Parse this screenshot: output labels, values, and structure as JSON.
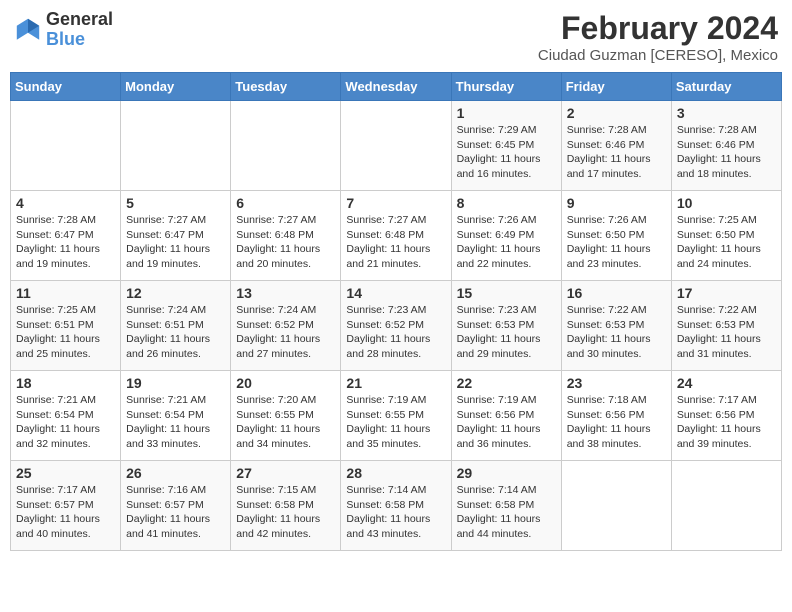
{
  "logo": {
    "general": "General",
    "blue": "Blue"
  },
  "title": {
    "month_year": "February 2024",
    "location": "Ciudad Guzman [CERESO], Mexico"
  },
  "days_of_week": [
    "Sunday",
    "Monday",
    "Tuesday",
    "Wednesday",
    "Thursday",
    "Friday",
    "Saturday"
  ],
  "weeks": [
    [
      {
        "day": "",
        "info": ""
      },
      {
        "day": "",
        "info": ""
      },
      {
        "day": "",
        "info": ""
      },
      {
        "day": "",
        "info": ""
      },
      {
        "day": "1",
        "info": "Sunrise: 7:29 AM\nSunset: 6:45 PM\nDaylight: 11 hours and 16 minutes."
      },
      {
        "day": "2",
        "info": "Sunrise: 7:28 AM\nSunset: 6:46 PM\nDaylight: 11 hours and 17 minutes."
      },
      {
        "day": "3",
        "info": "Sunrise: 7:28 AM\nSunset: 6:46 PM\nDaylight: 11 hours and 18 minutes."
      }
    ],
    [
      {
        "day": "4",
        "info": "Sunrise: 7:28 AM\nSunset: 6:47 PM\nDaylight: 11 hours and 19 minutes."
      },
      {
        "day": "5",
        "info": "Sunrise: 7:27 AM\nSunset: 6:47 PM\nDaylight: 11 hours and 19 minutes."
      },
      {
        "day": "6",
        "info": "Sunrise: 7:27 AM\nSunset: 6:48 PM\nDaylight: 11 hours and 20 minutes."
      },
      {
        "day": "7",
        "info": "Sunrise: 7:27 AM\nSunset: 6:48 PM\nDaylight: 11 hours and 21 minutes."
      },
      {
        "day": "8",
        "info": "Sunrise: 7:26 AM\nSunset: 6:49 PM\nDaylight: 11 hours and 22 minutes."
      },
      {
        "day": "9",
        "info": "Sunrise: 7:26 AM\nSunset: 6:50 PM\nDaylight: 11 hours and 23 minutes."
      },
      {
        "day": "10",
        "info": "Sunrise: 7:25 AM\nSunset: 6:50 PM\nDaylight: 11 hours and 24 minutes."
      }
    ],
    [
      {
        "day": "11",
        "info": "Sunrise: 7:25 AM\nSunset: 6:51 PM\nDaylight: 11 hours and 25 minutes."
      },
      {
        "day": "12",
        "info": "Sunrise: 7:24 AM\nSunset: 6:51 PM\nDaylight: 11 hours and 26 minutes."
      },
      {
        "day": "13",
        "info": "Sunrise: 7:24 AM\nSunset: 6:52 PM\nDaylight: 11 hours and 27 minutes."
      },
      {
        "day": "14",
        "info": "Sunrise: 7:23 AM\nSunset: 6:52 PM\nDaylight: 11 hours and 28 minutes."
      },
      {
        "day": "15",
        "info": "Sunrise: 7:23 AM\nSunset: 6:53 PM\nDaylight: 11 hours and 29 minutes."
      },
      {
        "day": "16",
        "info": "Sunrise: 7:22 AM\nSunset: 6:53 PM\nDaylight: 11 hours and 30 minutes."
      },
      {
        "day": "17",
        "info": "Sunrise: 7:22 AM\nSunset: 6:53 PM\nDaylight: 11 hours and 31 minutes."
      }
    ],
    [
      {
        "day": "18",
        "info": "Sunrise: 7:21 AM\nSunset: 6:54 PM\nDaylight: 11 hours and 32 minutes."
      },
      {
        "day": "19",
        "info": "Sunrise: 7:21 AM\nSunset: 6:54 PM\nDaylight: 11 hours and 33 minutes."
      },
      {
        "day": "20",
        "info": "Sunrise: 7:20 AM\nSunset: 6:55 PM\nDaylight: 11 hours and 34 minutes."
      },
      {
        "day": "21",
        "info": "Sunrise: 7:19 AM\nSunset: 6:55 PM\nDaylight: 11 hours and 35 minutes."
      },
      {
        "day": "22",
        "info": "Sunrise: 7:19 AM\nSunset: 6:56 PM\nDaylight: 11 hours and 36 minutes."
      },
      {
        "day": "23",
        "info": "Sunrise: 7:18 AM\nSunset: 6:56 PM\nDaylight: 11 hours and 38 minutes."
      },
      {
        "day": "24",
        "info": "Sunrise: 7:17 AM\nSunset: 6:56 PM\nDaylight: 11 hours and 39 minutes."
      }
    ],
    [
      {
        "day": "25",
        "info": "Sunrise: 7:17 AM\nSunset: 6:57 PM\nDaylight: 11 hours and 40 minutes."
      },
      {
        "day": "26",
        "info": "Sunrise: 7:16 AM\nSunset: 6:57 PM\nDaylight: 11 hours and 41 minutes."
      },
      {
        "day": "27",
        "info": "Sunrise: 7:15 AM\nSunset: 6:58 PM\nDaylight: 11 hours and 42 minutes."
      },
      {
        "day": "28",
        "info": "Sunrise: 7:14 AM\nSunset: 6:58 PM\nDaylight: 11 hours and 43 minutes."
      },
      {
        "day": "29",
        "info": "Sunrise: 7:14 AM\nSunset: 6:58 PM\nDaylight: 11 hours and 44 minutes."
      },
      {
        "day": "",
        "info": ""
      },
      {
        "day": "",
        "info": ""
      }
    ]
  ]
}
